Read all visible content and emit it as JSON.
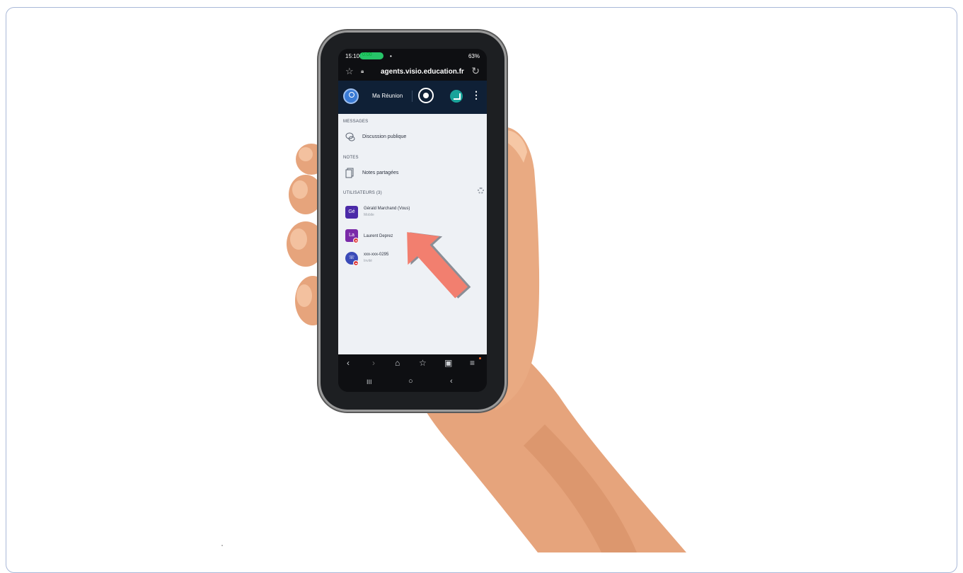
{
  "status_bar": {
    "time": "15:10",
    "call_pill": "0:00",
    "dot": "•",
    "right": "63%"
  },
  "url_bar": {
    "url": "agents.visio.education.fr"
  },
  "app_header": {
    "title": "Ma Réunion"
  },
  "panel": {
    "messages_label": "MESSAGES",
    "discussion_label": "Discussion publique",
    "notes_label": "NOTES",
    "shared_notes_label": "Notes partagées",
    "users_label": "UTILISATEURS (3)",
    "users": [
      {
        "initials": "Gé",
        "name": "Gérald Marchand (Vous)",
        "subtitle": "Mobile",
        "color": "#4b2aa8"
      },
      {
        "initials": "La",
        "name": "Laurent Deprez",
        "subtitle": "",
        "color": "#7a2aa8"
      },
      {
        "initials": "",
        "name": "xxx-xxx-0295",
        "subtitle": "Invité",
        "color": "#3a4ab8"
      }
    ]
  },
  "browser_nav": {
    "back": "‹",
    "forward": "›",
    "home": "⌂",
    "bookmark": "☆",
    "tabs": "▣",
    "menu": "≡"
  },
  "system_nav": {
    "recents": "III",
    "home": "○",
    "back": "‹"
  },
  "colors": {
    "arrow": "#f27f6f",
    "header_bg": "#0f2036",
    "skin": "#e8a97e"
  },
  "footer_mark": "\""
}
